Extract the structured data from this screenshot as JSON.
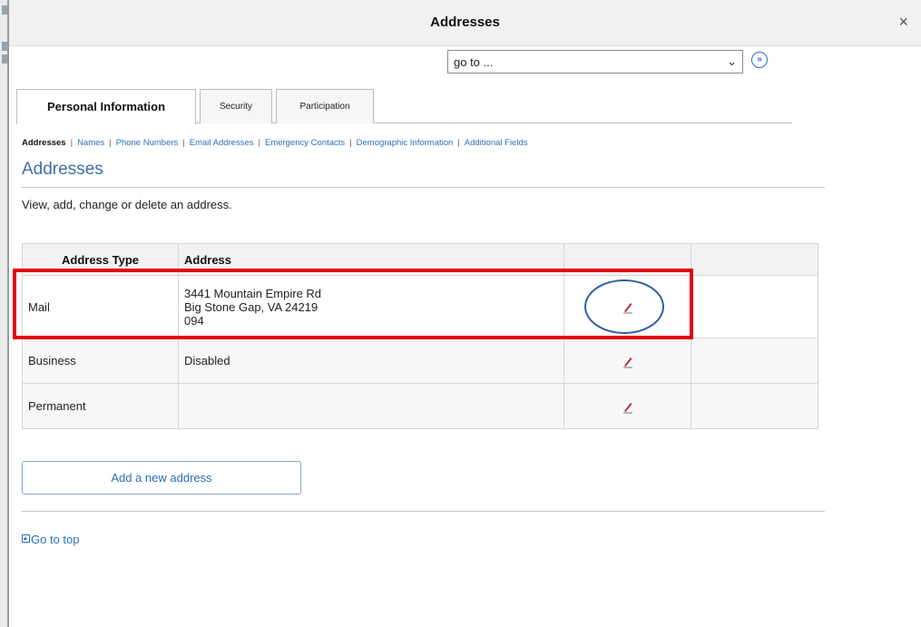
{
  "dialog": {
    "title": "Addresses",
    "close_glyph": "×"
  },
  "goto": {
    "value": "go to ...",
    "dropdown_glyph": "⌄",
    "go_glyph": "»"
  },
  "tabs": [
    {
      "label": "Personal Information",
      "active": true
    },
    {
      "label": "Security",
      "active": false
    },
    {
      "label": "Participation",
      "active": false
    }
  ],
  "subnav": [
    {
      "label": "Addresses",
      "current": true
    },
    {
      "label": "Names",
      "current": false
    },
    {
      "label": "Phone Numbers",
      "current": false
    },
    {
      "label": "Email Addresses",
      "current": false
    },
    {
      "label": "Emergency Contacts",
      "current": false
    },
    {
      "label": "Demographic Information",
      "current": false
    },
    {
      "label": "Additional Fields",
      "current": false
    }
  ],
  "page": {
    "heading": "Addresses",
    "description": "View, add, change or delete an address."
  },
  "table": {
    "headers": [
      "Address Type",
      "Address",
      "",
      ""
    ],
    "rows": [
      {
        "type": "Mail",
        "address_lines": [
          "3441 Mountain Empire Rd",
          "Big Stone Gap, VA 24219",
          "094"
        ]
      },
      {
        "type": "Business",
        "address_lines": [
          "Disabled"
        ]
      },
      {
        "type": "Permanent",
        "address_lines": []
      }
    ]
  },
  "actions": {
    "add_address": "Add a new address",
    "go_to_top": "Go to top"
  },
  "colors": {
    "accent": "#2c6ebd",
    "highlight_red": "#e3000f",
    "highlight_blue": "#2f5fa8",
    "edit_icon": "#b5273a"
  }
}
